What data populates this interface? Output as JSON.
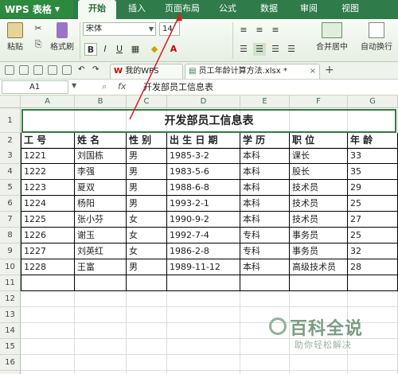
{
  "app": {
    "name": "WPS 表格"
  },
  "menu": {
    "tabs": [
      "开始",
      "插入",
      "页面布局",
      "公式",
      "数据",
      "审阅",
      "视图"
    ],
    "active": "开始"
  },
  "ribbon": {
    "paste_label": "粘贴",
    "format_painter_label": "格式刷",
    "font_name": "宋体",
    "font_size": "14",
    "merge_center_label": "合并居中",
    "wrap_label": "自动换行",
    "bold": "B",
    "italic": "I",
    "underline": "U",
    "font_color_glyph": "A",
    "accent_color": "#2f7b4a"
  },
  "doc_tabs": [
    {
      "label": "我的WPS"
    },
    {
      "label": "员工年龄计算方法.xlsx *"
    }
  ],
  "formula_bar": {
    "cell_ref": "A1",
    "fx": "fx",
    "content": "开发部员工信息表"
  },
  "sheet": {
    "columns": [
      "A",
      "B",
      "C",
      "D",
      "E",
      "F",
      "G"
    ],
    "rows": [
      "1",
      "2",
      "3",
      "4",
      "5",
      "6",
      "7",
      "8",
      "9",
      "10",
      "11",
      "12",
      "13",
      "14",
      "15",
      "16",
      "17",
      "18"
    ],
    "title": "开发部员工信息表",
    "headers": [
      "工 号",
      "姓 名",
      "性 别",
      "出 生 日 期",
      "学 历",
      "职 位",
      "年 龄"
    ],
    "data": [
      [
        "1221",
        "刘国栋",
        "男",
        "1985-3-2",
        "本科",
        "课长",
        "33"
      ],
      [
        "1222",
        "李强",
        "男",
        "1983-5-6",
        "本科",
        "股长",
        "35"
      ],
      [
        "1223",
        "夏双",
        "男",
        "1988-6-8",
        "本科",
        "技术员",
        "29"
      ],
      [
        "1224",
        "杨阳",
        "男",
        "1993-2-1",
        "本科",
        "技术员",
        "25"
      ],
      [
        "1225",
        "张小芬",
        "女",
        "1990-9-2",
        "本科",
        "技术员",
        "27"
      ],
      [
        "1226",
        "谢玉",
        "女",
        "1992-7-4",
        "专科",
        "事务员",
        "25"
      ],
      [
        "1227",
        "刘英红",
        "女",
        "1986-2-8",
        "专科",
        "事务员",
        "32"
      ],
      [
        "1228",
        "王富",
        "男",
        "1989-11-12",
        "本科",
        "高级技术员",
        "28"
      ]
    ]
  },
  "watermark": {
    "title": "百科全说",
    "subtitle": "助你轻松解决"
  }
}
